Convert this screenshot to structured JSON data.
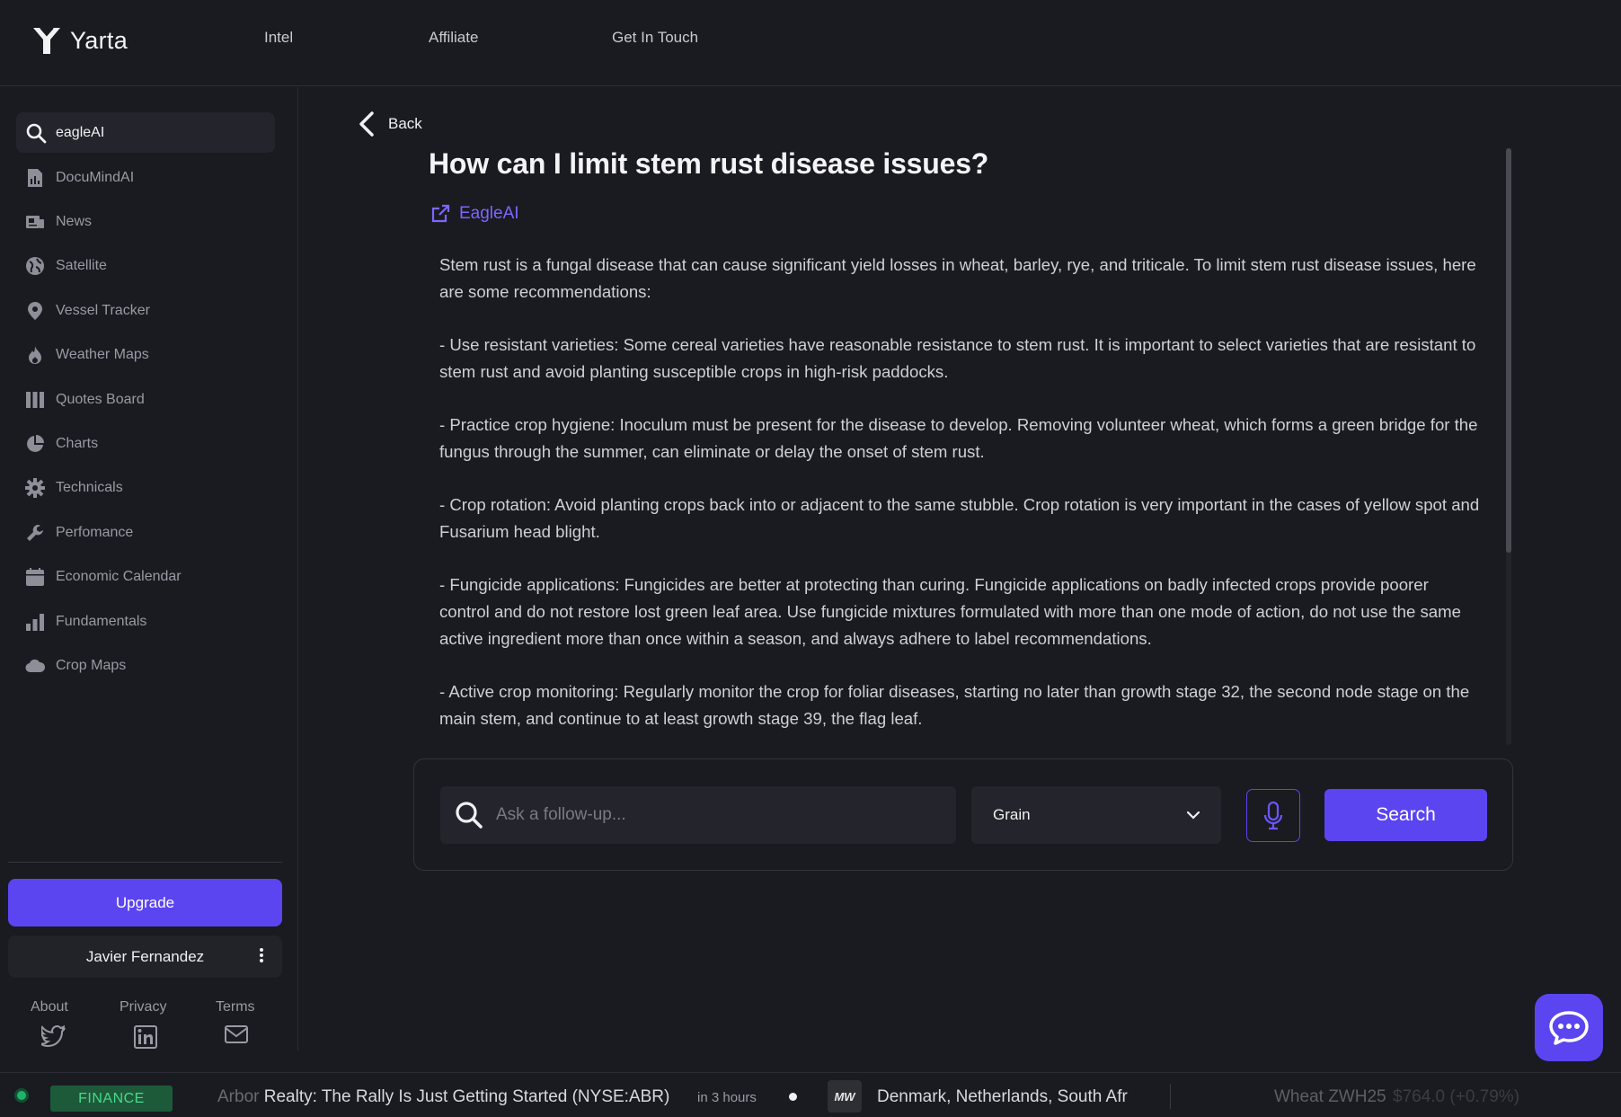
{
  "brand": {
    "name": "Yarta"
  },
  "nav": {
    "links": [
      "Intel",
      "Affiliate",
      "Get In Touch"
    ]
  },
  "sidebar": {
    "search_value": "eagleAI",
    "items": [
      {
        "label": "DocuMindAI",
        "icon": "document-chart-icon"
      },
      {
        "label": "News",
        "icon": "newspaper-icon"
      },
      {
        "label": "Satellite",
        "icon": "globe-icon"
      },
      {
        "label": "Vessel Tracker",
        "icon": "map-pin-icon"
      },
      {
        "label": "Weather Maps",
        "icon": "flame-icon"
      },
      {
        "label": "Quotes Board",
        "icon": "columns-icon"
      },
      {
        "label": "Charts",
        "icon": "pie-chart-icon"
      },
      {
        "label": "Technicals",
        "icon": "gear-icon"
      },
      {
        "label": "Perfomance",
        "icon": "wrench-icon"
      },
      {
        "label": "Economic Calendar",
        "icon": "calendar-icon"
      },
      {
        "label": "Fundamentals",
        "icon": "bar-chart-icon"
      },
      {
        "label": "Crop Maps",
        "icon": "cloud-icon"
      }
    ],
    "upgrade_label": "Upgrade",
    "user_name": "Javier Fernandez",
    "footer": {
      "about": "About",
      "privacy": "Privacy",
      "terms": "Terms"
    }
  },
  "main": {
    "back_label": "Back",
    "title": "How can I limit stem rust disease issues?",
    "source_label": "EagleAI",
    "paragraphs": [
      "Stem rust is a fungal disease that can cause significant yield losses in wheat, barley, rye, and triticale. To limit stem rust disease issues, here are some recommendations:",
      "- Use resistant varieties: Some cereal varieties have reasonable resistance to stem rust. It is important to select varieties that are resistant to stem rust and avoid planting susceptible crops in high-risk paddocks.",
      "- Practice crop hygiene: Inoculum must be present for the disease to develop. Removing volunteer wheat, which forms a green bridge for the fungus through the summer, can eliminate or delay the onset of stem rust.",
      "- Crop rotation: Avoid planting crops back into or adjacent to the same stubble. Crop rotation is very important in the cases of yellow spot and Fusarium head blight.",
      "- Fungicide applications: Fungicides are better at protecting than curing. Fungicide applications on badly infected crops provide poorer control and do not restore lost green leaf area. Use fungicide mixtures formulated with more than one mode of action, do not use the same active ingredient more than once within a season, and always adhere to label recommendations.",
      "- Active crop monitoring: Regularly monitor the crop for foliar diseases, starting no later than growth stage 32, the second node stage on the main stem, and continue to at least growth stage 39, the flag leaf."
    ]
  },
  "ask": {
    "placeholder": "Ask a follow-up...",
    "category": "Grain",
    "search_label": "Search"
  },
  "ticker": {
    "badge": "FINANCE",
    "headline_prefix": "Arbor",
    "headline": " Realty: The Rally Is Just Getting Started (NYSE:ABR)",
    "time": "in 3 hours",
    "source_badge": "MW",
    "headline2": "Denmark, Netherlands, South Afr",
    "quote_name": "Wheat ZWH25",
    "quote_value": "$764.0 (+0.79%)"
  },
  "colors": {
    "accent": "#5b45f0",
    "link": "#7b67ff",
    "finance_green": "#49d98a"
  }
}
